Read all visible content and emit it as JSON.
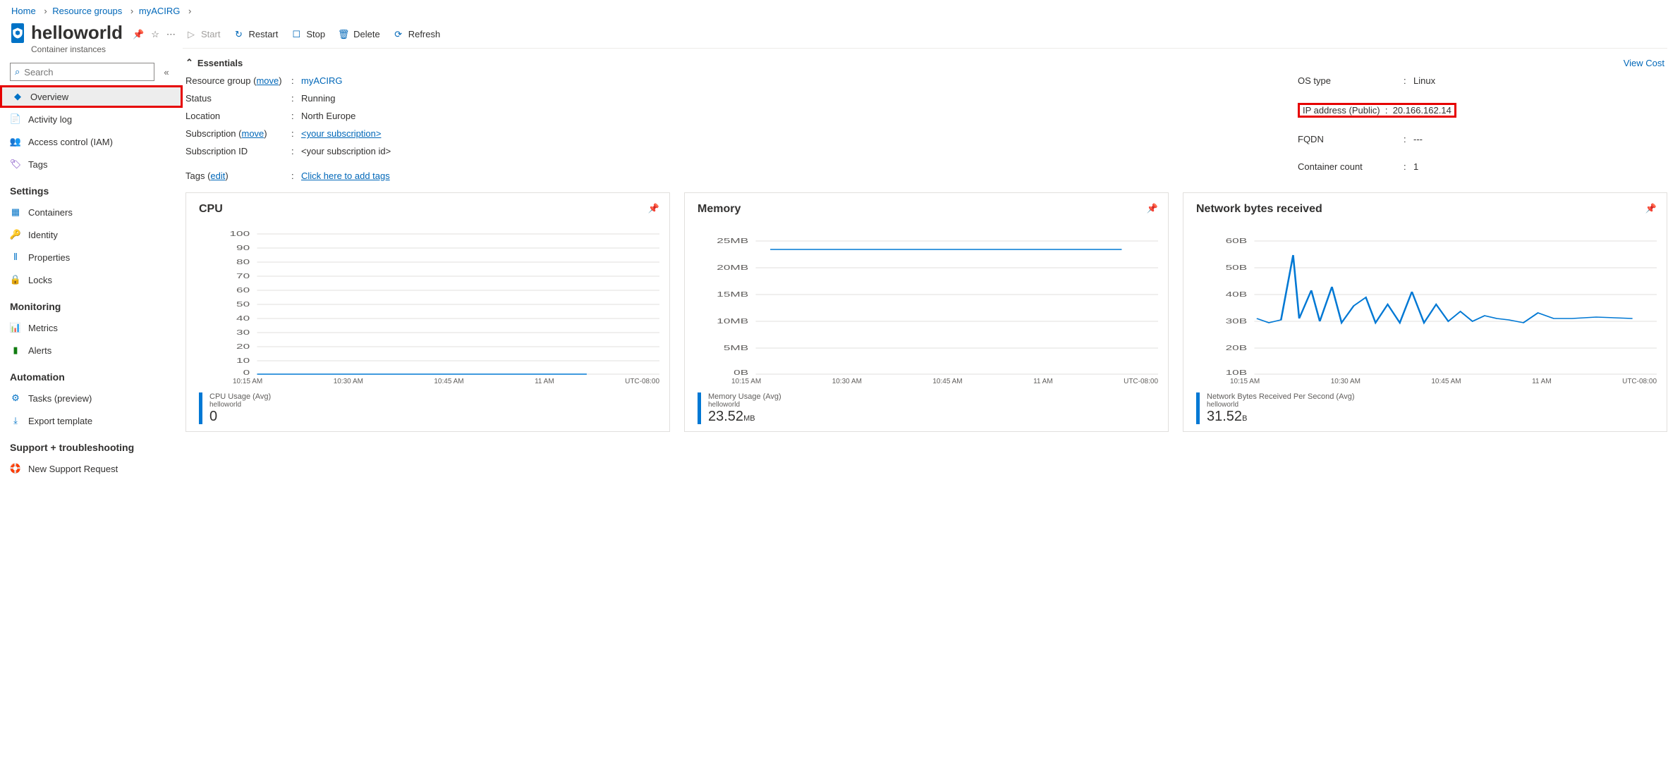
{
  "breadcrumb": {
    "home": "Home",
    "rg": "Resource groups",
    "rgName": "myACIRG"
  },
  "header": {
    "title": "helloworld",
    "subtitle": "Container instances"
  },
  "search": {
    "placeholder": "Search"
  },
  "sidebar": {
    "overview": "Overview",
    "activity": "Activity log",
    "iam": "Access control (IAM)",
    "tags": "Tags",
    "settingsHdr": "Settings",
    "containers": "Containers",
    "identity": "Identity",
    "properties": "Properties",
    "locks": "Locks",
    "monitoringHdr": "Monitoring",
    "metrics": "Metrics",
    "alerts": "Alerts",
    "automationHdr": "Automation",
    "tasks": "Tasks (preview)",
    "export": "Export template",
    "supportHdr": "Support + troubleshooting",
    "support": "New Support Request"
  },
  "toolbar": {
    "start": "Start",
    "restart": "Restart",
    "stop": "Stop",
    "delete": "Delete",
    "refresh": "Refresh"
  },
  "essentials": {
    "heading": "Essentials",
    "viewCost": "View Cost",
    "left": {
      "resourceGroupK": "Resource group",
      "move1": "move",
      "resourceGroupV": "myACIRG",
      "statusK": "Status",
      "statusV": "Running",
      "locationK": "Location",
      "locationV": "North Europe",
      "subscriptionK": "Subscription",
      "move2": "move",
      "subscriptionV": "<your subscription>",
      "subIdK": "Subscription ID",
      "subIdV": "<your subscription id>",
      "tagsK": "Tags",
      "tagsEdit": "edit",
      "tagsV": "Click here to add tags"
    },
    "right": {
      "osK": "OS type",
      "osV": "Linux",
      "ipK": "IP address (Public)",
      "ipV": "20.166.162.14",
      "fqdnK": "FQDN",
      "fqdnV": "---",
      "countK": "Container count",
      "countV": "1"
    }
  },
  "charts": {
    "cpu": {
      "title": "CPU",
      "legendName": "CPU Usage (Avg)",
      "legendSeries": "helloworld",
      "value": "0",
      "unit": ""
    },
    "memory": {
      "title": "Memory",
      "legendName": "Memory Usage (Avg)",
      "legendSeries": "helloworld",
      "value": "23.52",
      "unit": "MB"
    },
    "net": {
      "title": "Network bytes received",
      "legendName": "Network Bytes Received Per Second (Avg)",
      "legendSeries": "helloworld",
      "value": "31.52",
      "unit": "B"
    },
    "xlabels": [
      "10:15 AM",
      "10:30 AM",
      "10:45 AM",
      "11 AM",
      "UTC-08:00"
    ]
  },
  "chart_data": [
    {
      "type": "line",
      "title": "CPU",
      "ylabel": "",
      "ylim": [
        0,
        100
      ],
      "yticks": [
        0,
        10,
        20,
        30,
        40,
        50,
        60,
        70,
        80,
        90,
        100
      ],
      "x": [
        "10:15 AM",
        "10:30 AM",
        "10:45 AM",
        "11 AM"
      ],
      "series": [
        {
          "name": "CPU Usage (Avg) helloworld",
          "values": [
            0,
            0,
            0,
            0
          ]
        }
      ]
    },
    {
      "type": "line",
      "title": "Memory",
      "ylabel": "MB",
      "ylim": [
        0,
        25
      ],
      "yticks": [
        "0B",
        "5MB",
        "10MB",
        "15MB",
        "20MB",
        "25MB"
      ],
      "x": [
        "10:15 AM",
        "10:30 AM",
        "10:45 AM",
        "11 AM"
      ],
      "series": [
        {
          "name": "Memory Usage (Avg) helloworld",
          "values": [
            23.5,
            23.5,
            23.5,
            23.5
          ]
        }
      ]
    },
    {
      "type": "line",
      "title": "Network bytes received",
      "ylabel": "B",
      "ylim": [
        10,
        60
      ],
      "yticks": [
        "10B",
        "20B",
        "30B",
        "40B",
        "50B",
        "60B"
      ],
      "x": [
        "10:15 AM",
        "10:30 AM",
        "10:45 AM",
        "11 AM"
      ],
      "series": [
        {
          "name": "Network Bytes Received Per Second (Avg) helloworld",
          "values": [
            30,
            55,
            30,
            32,
            28,
            38,
            30,
            40,
            30,
            36,
            30,
            34,
            30,
            38,
            30,
            36,
            30,
            32,
            30,
            34,
            30,
            30,
            32,
            30,
            31,
            30,
            31,
            30
          ]
        }
      ]
    }
  ]
}
